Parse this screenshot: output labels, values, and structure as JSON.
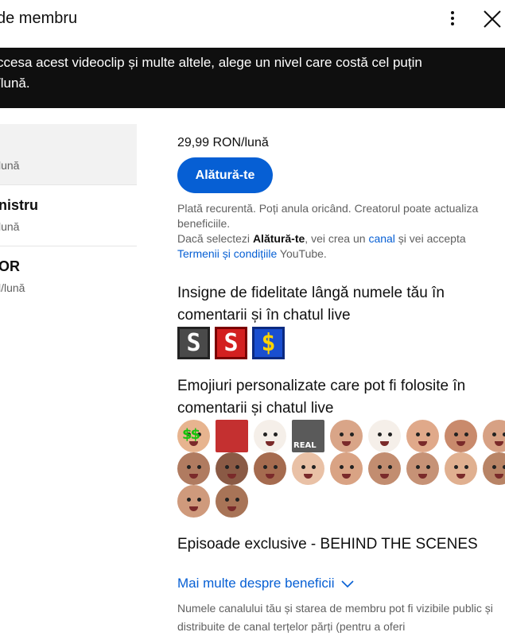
{
  "header": {
    "title": "de membru"
  },
  "banner": {
    "line1": "ccesa acest videoclip și multe altele, alege un nivel care costă cel puțin",
    "line2": "/lună."
  },
  "tiers": [
    {
      "name": "",
      "price": "lună"
    },
    {
      "name": "nistru",
      "price": "lună"
    },
    {
      "name": "OR",
      "price": "l/lună"
    }
  ],
  "main": {
    "price": "29,99 RON/lună",
    "join_label": "Alătură-te",
    "legal_line1": "Plată recurentă. Poți anula oricând. Creatorul poate actualiza beneficiile.",
    "legal_pre": "Dacă selectezi ",
    "legal_bold": "Alătură-te",
    "legal_mid": ", vei crea un ",
    "legal_link_channel": "canal",
    "legal_mid2": " și vei accepta ",
    "legal_link_terms": "Termenii și condițiile",
    "legal_post": " YouTube."
  },
  "perks": {
    "badges_title": "Insigne de fidelitate lângă numele tău în comentarii și în chatul live",
    "badges": [
      {
        "icon": "badge-icon-1",
        "glyph": "S",
        "color": "#4a4a4a"
      },
      {
        "icon": "badge-icon-2",
        "glyph": "S",
        "color": "#d32020"
      },
      {
        "icon": "badge-icon-3",
        "glyph": "$",
        "color": "#1a4fd0"
      }
    ],
    "emoji_title": "Emojiuri personalizate care pot fi folosite în comentarii și chatul live",
    "emojis": [
      {
        "icon": "money-eyes-emoji-icon",
        "color": "#e7b48f",
        "label": ""
      },
      {
        "icon": "flag-emoji-icon",
        "color": "#c43030",
        "label": ""
      },
      {
        "icon": "cartoon-emoji-icon",
        "color": "#f5efe9",
        "label": ""
      },
      {
        "icon": "real-emoji-icon",
        "color": "#5a5a5a",
        "label": "REAL"
      },
      {
        "icon": "face-emoji-icon",
        "color": "#d9a588",
        "label": ""
      },
      {
        "icon": "cartoon-emoji-icon-2",
        "color": "#f5efe9",
        "label": ""
      },
      {
        "icon": "face-emoji-icon-2",
        "color": "#e0a98a",
        "label": ""
      },
      {
        "icon": "face-emoji-icon-3",
        "color": "#c98a6c",
        "label": ""
      },
      {
        "icon": "face-emoji-icon-4",
        "color": "#d7a184",
        "label": ""
      },
      {
        "icon": "face-emoji-icon-5",
        "color": "#b07b60",
        "label": ""
      },
      {
        "icon": "face-emoji-icon-6",
        "color": "#8a5a45",
        "label": ""
      },
      {
        "icon": "face-emoji-icon-7",
        "color": "#a56b4f",
        "label": ""
      },
      {
        "icon": "face-emoji-icon-8",
        "color": "#e9c1a6",
        "label": ""
      },
      {
        "icon": "face-emoji-icon-9",
        "color": "#d9a384",
        "label": ""
      },
      {
        "icon": "face-emoji-icon-10",
        "color": "#c28d70",
        "label": ""
      },
      {
        "icon": "face-emoji-icon-11",
        "color": "#c69276",
        "label": ""
      },
      {
        "icon": "face-emoji-icon-12",
        "color": "#e0b090",
        "label": ""
      },
      {
        "icon": "face-emoji-icon-13",
        "color": "#b88466",
        "label": ""
      },
      {
        "icon": "face-emoji-icon-14",
        "color": "#cf9a7c",
        "label": ""
      },
      {
        "icon": "face-emoji-icon-15",
        "color": "#a87457",
        "label": ""
      }
    ],
    "exclusive_title": "Episoade exclusive - BEHIND THE SCENES"
  },
  "more_benefits_label": "Mai multe despre beneficii",
  "footnote": "Numele canalului tău și starea de membru pot fi vizibile public și distribuite de canal terțelor părți (pentru a oferi",
  "colors": {
    "accent": "#065fd4",
    "banner_bg": "#0f0f0f",
    "selected_bg": "#f2f2f2",
    "secondary_text": "#606060"
  }
}
